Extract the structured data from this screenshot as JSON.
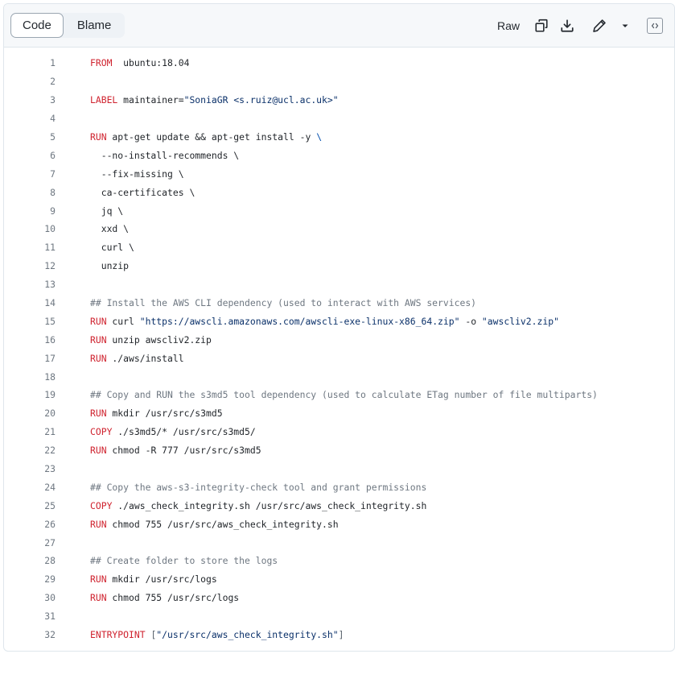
{
  "header": {
    "tabs": [
      {
        "label": "Code",
        "active": true
      },
      {
        "label": "Blame",
        "active": false
      }
    ],
    "raw_label": "Raw",
    "icons": [
      "copy-icon",
      "download-icon",
      "pencil-icon",
      "triangle-down-icon",
      "code-symbols-icon"
    ]
  },
  "colors": {
    "keyword": "#cf222e",
    "string": "#0a3069",
    "comment": "#6e7781",
    "line_number": "#6e7781"
  },
  "code": {
    "lines": [
      {
        "n": "1",
        "tokens": [
          [
            "kw",
            "FROM"
          ],
          [
            "",
            "  ubuntu:18.04"
          ]
        ]
      },
      {
        "n": "2",
        "tokens": []
      },
      {
        "n": "3",
        "tokens": [
          [
            "kw",
            "LABEL"
          ],
          [
            "",
            " maintainer="
          ],
          [
            "str",
            "\"SoniaGR <s.ruiz@ucl.ac.uk>\""
          ]
        ]
      },
      {
        "n": "4",
        "tokens": []
      },
      {
        "n": "5",
        "tokens": [
          [
            "kw",
            "RUN"
          ],
          [
            "",
            " apt-get update && apt-get install -y "
          ],
          [
            "esc",
            "\\"
          ]
        ]
      },
      {
        "n": "6",
        "tokens": [
          [
            "",
            "  --no-install-recommends \\"
          ]
        ]
      },
      {
        "n": "7",
        "tokens": [
          [
            "",
            "  --fix-missing \\"
          ]
        ]
      },
      {
        "n": "8",
        "tokens": [
          [
            "",
            "  ca-certificates \\"
          ]
        ]
      },
      {
        "n": "9",
        "tokens": [
          [
            "",
            "  jq \\"
          ]
        ]
      },
      {
        "n": "10",
        "tokens": [
          [
            "",
            "  xxd \\"
          ]
        ]
      },
      {
        "n": "11",
        "tokens": [
          [
            "",
            "  curl \\"
          ]
        ]
      },
      {
        "n": "12",
        "tokens": [
          [
            "",
            "  unzip"
          ]
        ]
      },
      {
        "n": "13",
        "tokens": []
      },
      {
        "n": "14",
        "tokens": [
          [
            "cm",
            "## Install the AWS CLI dependency (used to interact with AWS services)"
          ]
        ]
      },
      {
        "n": "15",
        "tokens": [
          [
            "kw",
            "RUN"
          ],
          [
            "",
            " curl "
          ],
          [
            "str",
            "\"https://awscli.amazonaws.com/awscli-exe-linux-x86_64.zip\""
          ],
          [
            "",
            " -o "
          ],
          [
            "str",
            "\"awscliv2.zip\""
          ]
        ]
      },
      {
        "n": "16",
        "tokens": [
          [
            "kw",
            "RUN"
          ],
          [
            "",
            " unzip awscliv2.zip"
          ]
        ]
      },
      {
        "n": "17",
        "tokens": [
          [
            "kw",
            "RUN"
          ],
          [
            "",
            " ./aws/install"
          ]
        ]
      },
      {
        "n": "18",
        "tokens": []
      },
      {
        "n": "19",
        "tokens": [
          [
            "cm",
            "## Copy and RUN the s3md5 tool dependency (used to calculate ETag number of file multiparts)"
          ]
        ]
      },
      {
        "n": "20",
        "tokens": [
          [
            "kw",
            "RUN"
          ],
          [
            "",
            " mkdir /usr/src/s3md5"
          ]
        ]
      },
      {
        "n": "21",
        "tokens": [
          [
            "kw",
            "COPY"
          ],
          [
            "",
            " ./s3md5/* /usr/src/s3md5/"
          ]
        ]
      },
      {
        "n": "22",
        "tokens": [
          [
            "kw",
            "RUN"
          ],
          [
            "",
            " chmod -R 777 /usr/src/s3md5"
          ]
        ]
      },
      {
        "n": "23",
        "tokens": []
      },
      {
        "n": "24",
        "tokens": [
          [
            "cm",
            "## Copy the aws-s3-integrity-check tool and grant permissions"
          ]
        ]
      },
      {
        "n": "25",
        "tokens": [
          [
            "kw",
            "COPY"
          ],
          [
            "",
            " ./aws_check_integrity.sh /usr/src/aws_check_integrity.sh"
          ]
        ]
      },
      {
        "n": "26",
        "tokens": [
          [
            "kw",
            "RUN"
          ],
          [
            "",
            " chmod 755 /usr/src/aws_check_integrity.sh"
          ]
        ]
      },
      {
        "n": "27",
        "tokens": []
      },
      {
        "n": "28",
        "tokens": [
          [
            "cm",
            "## Create folder to store the logs"
          ]
        ]
      },
      {
        "n": "29",
        "tokens": [
          [
            "kw",
            "RUN"
          ],
          [
            "",
            " mkdir /usr/src/logs"
          ]
        ]
      },
      {
        "n": "30",
        "tokens": [
          [
            "kw",
            "RUN"
          ],
          [
            "",
            " chmod 755 /usr/src/logs"
          ]
        ]
      },
      {
        "n": "31",
        "tokens": []
      },
      {
        "n": "32",
        "tokens": [
          [
            "kw",
            "ENTRYPOINT"
          ],
          [
            "",
            " "
          ],
          [
            "pun",
            "["
          ],
          [
            "str",
            "\"/usr/src/aws_check_integrity.sh\""
          ],
          [
            "pun",
            "]"
          ]
        ]
      }
    ]
  }
}
